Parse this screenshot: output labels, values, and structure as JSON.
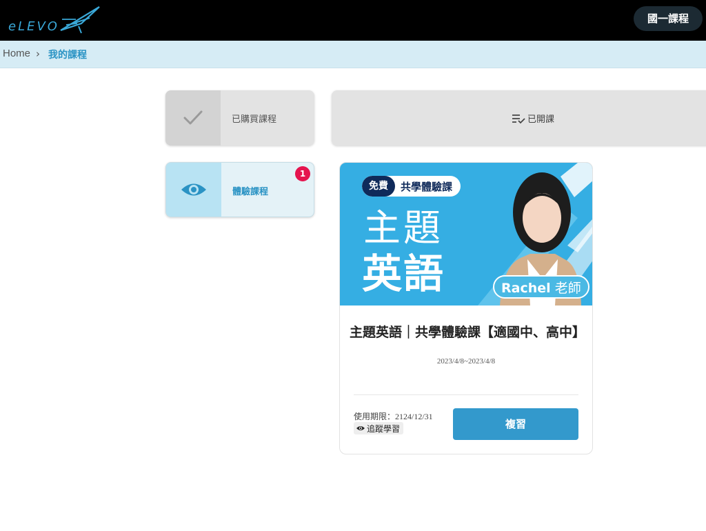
{
  "header": {
    "logo_text": "eLEVO",
    "grade_button": "國一課程"
  },
  "breadcrumb": {
    "home": "Home",
    "separator": "›",
    "current": "我的課程"
  },
  "sidebar": {
    "items": [
      {
        "label": "已購買課程",
        "icon": "check-icon",
        "active": false
      },
      {
        "label": "體驗課程",
        "icon": "eye-icon",
        "active": true,
        "badge": "1"
      }
    ]
  },
  "tabs": {
    "opened_label": "已開課",
    "opened_icon": "list-check-icon"
  },
  "course": {
    "banner": {
      "free_label": "免費",
      "tag_label": "共學體驗課",
      "title_line1": "主題",
      "title_line2": "英語",
      "teacher_name": "Rachel",
      "teacher_suffix": "老師"
    },
    "title": "主題英語｜共學體驗課【適國中、高中】",
    "dates": "2023/4/8~2023/4/8",
    "expiry": "使用期限：2124/12/31",
    "follow_label": "追蹤學習",
    "review_button": "複習"
  },
  "colors": {
    "topbar": "#000000",
    "accent": "#3399cc",
    "breadcrumb_bg": "#d6ecf5",
    "badge": "#e5144e",
    "banner": "#35aee3"
  }
}
